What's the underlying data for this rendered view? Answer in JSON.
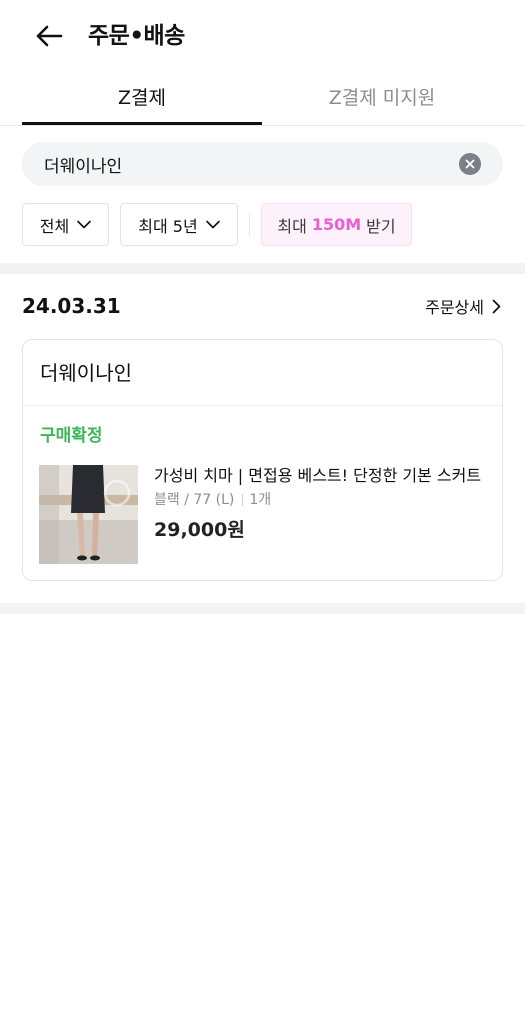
{
  "header": {
    "title": "주문•배송"
  },
  "tabs": [
    {
      "label": "Z결제",
      "active": true
    },
    {
      "label": "Z결제 미지원",
      "active": false
    }
  ],
  "search": {
    "value": "더웨이나인"
  },
  "filters": {
    "type": "전체",
    "period": "최대 5년",
    "promo_prefix": "최대",
    "promo_amount": "150M",
    "promo_suffix": "받기"
  },
  "order": {
    "date": "24.03.31",
    "detail_link": "주문상세",
    "store": "더웨이나인",
    "status": "구매확정",
    "item": {
      "title": "가성비 치마 | 면접용 베스트! 단정한 기본 스커트",
      "option": "블랙 / 77 (L)",
      "qty": "1개",
      "price": "29,000원"
    }
  },
  "colors": {
    "accent_pink": "#ea5fd3",
    "status_green": "#3fb55a"
  }
}
